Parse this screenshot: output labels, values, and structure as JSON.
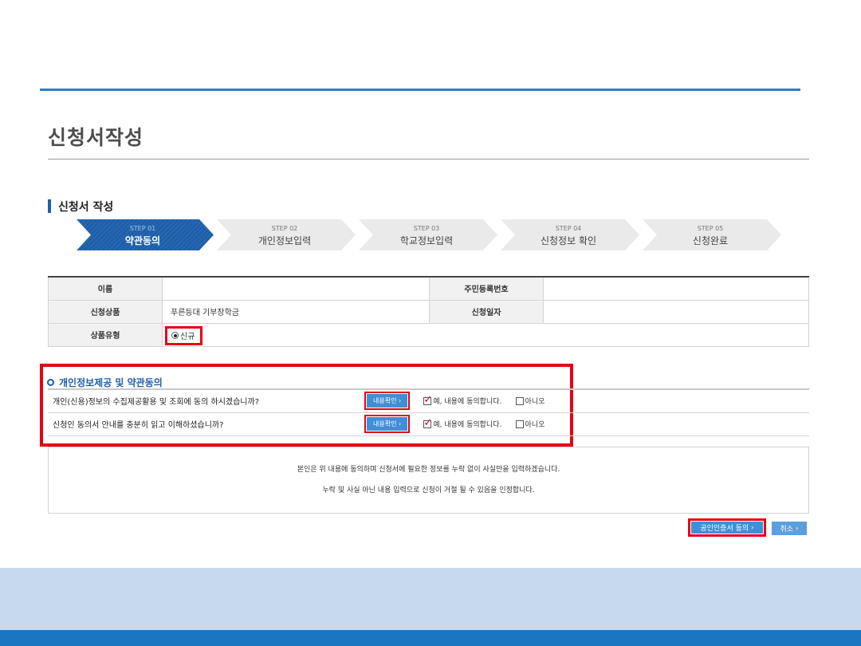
{
  "page": {
    "title": "신청서작성"
  },
  "section": {
    "title": "신청서 작성"
  },
  "steps": [
    {
      "num": "STEP 01",
      "label": "약관동의",
      "active": true
    },
    {
      "num": "STEP 02",
      "label": "개인정보입력",
      "active": false
    },
    {
      "num": "STEP 03",
      "label": "학교정보입력",
      "active": false
    },
    {
      "num": "STEP 04",
      "label": "신청정보 확인",
      "active": false
    },
    {
      "num": "STEP 05",
      "label": "신청완료",
      "active": false
    }
  ],
  "info": {
    "name_label": "이름",
    "name_value": "",
    "rrn_label": "주민등록번호",
    "rrn_value": "",
    "product_label": "신청상품",
    "product_value": "푸른등대 기부장학금",
    "date_label": "신청일자",
    "date_value": "",
    "type_label": "상품유형",
    "type_value": "신규"
  },
  "consent": {
    "title": "개인정보제공 및 약관동의",
    "view_label": "내용확인",
    "yes_label": "예, 내용에 동의합니다.",
    "no_label": "아니오",
    "rows": [
      {
        "question": "개인(신용)정보의 수집제공활용 및 조회에 동의 하시겠습니까?",
        "yes_checked": true,
        "no_checked": false
      },
      {
        "question": "신청인 동의서 안내를 충분히 읽고 이해하셨습니까?",
        "yes_checked": true,
        "no_checked": false
      }
    ]
  },
  "notice": {
    "line1": "본인은 위 내용에 동의하며 신청서에 필요한 정보를 누락 없이 사실만을 입력하겠습니다.",
    "line2": "누락 및 사실 아닌 내용 입력으로 신청이 거절 될 수 있음을 인정합니다."
  },
  "buttons": {
    "cert": "공인인증서 동의",
    "cancel": "취소"
  },
  "colors": {
    "primary_blue": "#1f5ea8",
    "highlight_red": "#e60012",
    "footer_light": "#c7d9ef",
    "footer_dark": "#1a76c0"
  }
}
